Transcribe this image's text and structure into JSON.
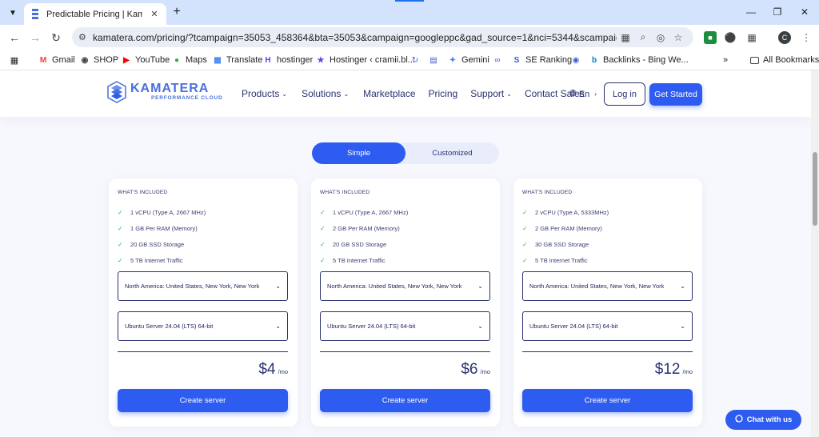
{
  "browser": {
    "tab_title": "Predictable Pricing | Kamatera",
    "url": "kamatera.com/pricing/?tcampaign=35053_458364&bta=35053&campaign=googleppc&gad_source=1&nci=5344&scampaign=kamater...",
    "profile_initial": "C",
    "bookmarks": [
      {
        "label": "Gmail",
        "icon": "gmail-icon",
        "color": "#ea4335"
      },
      {
        "label": "SHOP",
        "icon": "globe-icon",
        "color": "#444444"
      },
      {
        "label": "YouTube",
        "icon": "youtube-icon",
        "color": "#ff0000"
      },
      {
        "label": "Maps",
        "icon": "maps-icon",
        "color": "#34a853"
      },
      {
        "label": "Translate",
        "icon": "translate-icon",
        "color": "#4285f4"
      },
      {
        "label": "hostinger",
        "icon": "hostinger-icon",
        "color": "#673de6"
      },
      {
        "label": "Hostinger ‹ cramii.bl...",
        "icon": "wordpress-icon",
        "color": "#673de6"
      },
      {
        "label": "Gemini",
        "icon": "gemini-icon",
        "color": "#4285f4"
      },
      {
        "label": "SE Ranking",
        "icon": "se-ranking-icon",
        "color": "#3b5bdb"
      },
      {
        "label": "Backlinks - Bing We...",
        "icon": "bing-icon",
        "color": "#0078d4"
      }
    ],
    "all_bookmarks": "All Bookmarks"
  },
  "site": {
    "logo_name": "KAMATERA",
    "logo_tagline": "PERFORMANCE CLOUD",
    "nav": [
      {
        "label": "Products",
        "dropdown": true
      },
      {
        "label": "Solutions",
        "dropdown": true
      },
      {
        "label": "Marketplace",
        "dropdown": false
      },
      {
        "label": "Pricing",
        "dropdown": false
      },
      {
        "label": "Support",
        "dropdown": true
      },
      {
        "label": "Contact Sales",
        "dropdown": false
      }
    ],
    "language": "En",
    "login": "Log in",
    "get_started": "Get Started",
    "accent_color": "#2f5cf0"
  },
  "pricing": {
    "toggle": {
      "simple": "Simple",
      "customized": "Customized",
      "selected": "Simple"
    },
    "included_label": "WHAT'S INCLUDED",
    "plans": [
      {
        "features": [
          "1 vCPU (Type A, 2667 MHz)",
          "1 GB Per RAM (Memory)",
          "20 GB SSD Storage",
          "5 TB Internet Traffic"
        ],
        "location": "North America: United States, New York, New York",
        "os": "Ubuntu Server 24.04 (LTS) 64-bit",
        "price": "$4",
        "period": "/mo",
        "button": "Create server"
      },
      {
        "features": [
          "1 vCPU (Type A, 2667 MHz)",
          "2 GB Per RAM (Memory)",
          "20 GB SSD Storage",
          "5 TB Internet Traffic"
        ],
        "location": "North America: United States, New York, New York",
        "os": "Ubuntu Server 24.04 (LTS) 64-bit",
        "price": "$6",
        "period": "/mo",
        "button": "Create server"
      },
      {
        "features": [
          "2 vCPU (Type A, 5333MHz)",
          "2 GB Per RAM (Memory)",
          "30 GB SSD Storage",
          "5 TB Internet Traffic"
        ],
        "location": "North America: United States, New York, New York",
        "os": "Ubuntu Server 24.04 (LTS) 64-bit",
        "price": "$12",
        "period": "/mo",
        "button": "Create server"
      }
    ]
  },
  "chat": {
    "label": "Chat with us"
  }
}
